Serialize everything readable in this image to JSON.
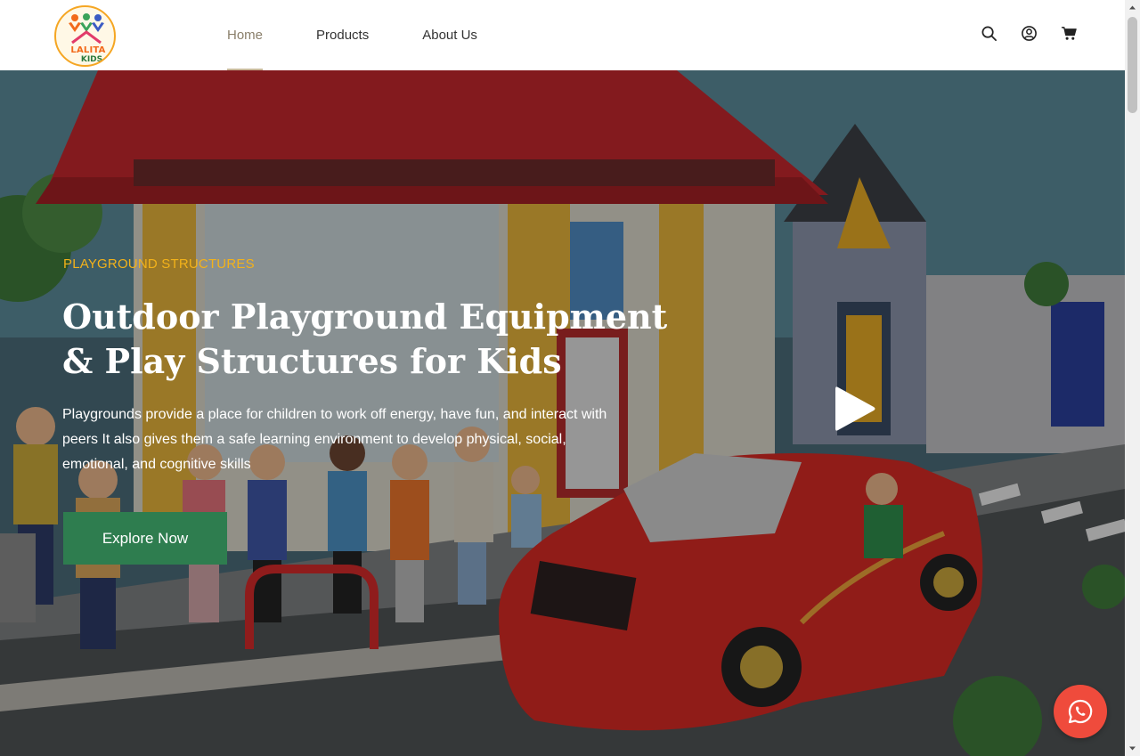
{
  "header": {
    "logo": {
      "line1": "LALITA",
      "line2": "KIDS"
    },
    "nav": [
      {
        "label": "Home",
        "active": true
      },
      {
        "label": "Products",
        "active": false
      },
      {
        "label": "About Us",
        "active": false
      }
    ],
    "icons": [
      "search-icon",
      "user-account-icon",
      "cart-icon"
    ]
  },
  "hero": {
    "eyebrow": "PLAYGROUND STRUCTURES",
    "title_line1": "Outdoor Playground Equipment",
    "title_line2": "& Play Structures for Kids",
    "description": "Playgrounds provide a place for children to work off energy, have fun, and interact with peers It also gives them a safe learning environment to develop physical, social, emotional, and cognitive skills",
    "cta_label": "Explore Now",
    "play_icon": "play-icon"
  },
  "colors": {
    "accent_green": "#2e7d4f",
    "eyebrow_yellow": "#f3b21a",
    "whatsapp_button": "#ef4b3c",
    "nav_active": "#8a7f6b"
  },
  "floating": {
    "icon": "whatsapp-icon"
  }
}
